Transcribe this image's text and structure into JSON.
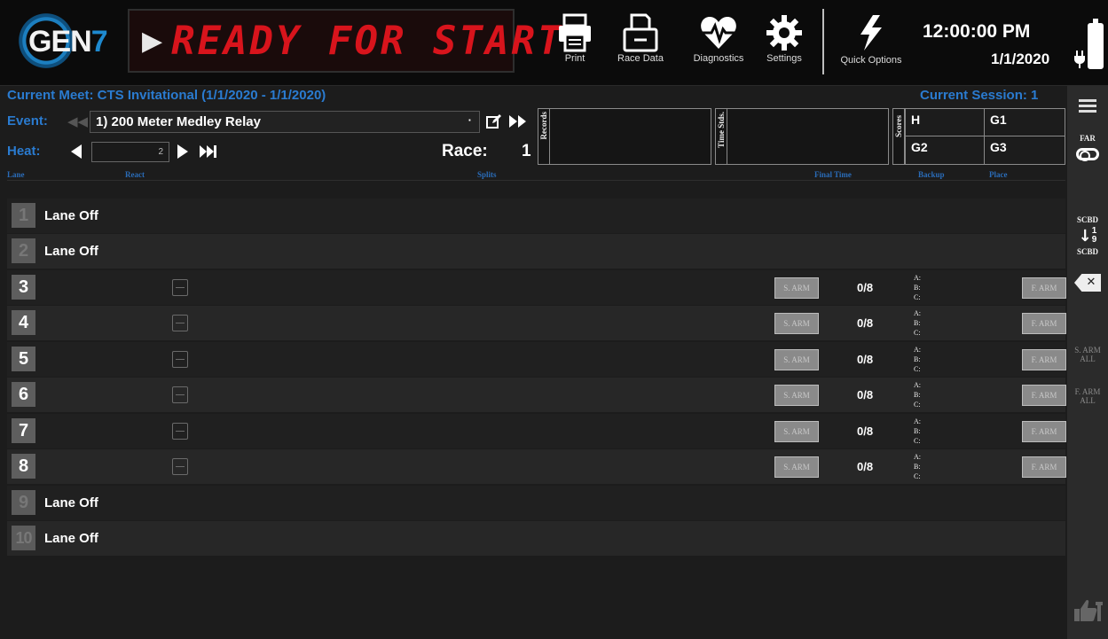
{
  "header": {
    "logo_text": "GEN",
    "logo_seven": "7",
    "status_arrow": "▶",
    "status_text": "READY FOR START",
    "tools": [
      {
        "label": "Print",
        "icon": "printer-icon"
      },
      {
        "label": "Race Data",
        "icon": "race-data-icon"
      },
      {
        "label": "Diagnostics",
        "icon": "heart-pulse-icon"
      },
      {
        "label": "Settings",
        "icon": "gear-icon"
      },
      {
        "label": "Quick Options",
        "icon": "lightning-icon"
      }
    ],
    "time": "12:00:00 PM",
    "date": "1/1/2020"
  },
  "meet": {
    "current_meet": "Current Meet: CTS Invitational (1/1/2020 - 1/1/2020)",
    "current_session": "Current Session: 1"
  },
  "controls": {
    "event_label": "Event:",
    "event_value": "1) 200 Meter Medley Relay",
    "heat_label": "Heat:",
    "heat_value": "2",
    "race_label": "Race:",
    "race_value": "1",
    "records_label": "Records",
    "time_stds_label": "Time Stds.",
    "scores_label": "Scores",
    "scores": [
      "H",
      "G1",
      "G2",
      "G3"
    ]
  },
  "columns": {
    "lane": "Lane",
    "react": "React",
    "splits": "Splits",
    "final_time": "Final Time",
    "backup": "Backup",
    "place": "Place"
  },
  "sidebar": {
    "far": "FAR",
    "scbd_top": "SCBD",
    "scbd_num_top": "1",
    "scbd_num_bottom": "9",
    "scbd_bottom": "SCBD",
    "s_arm_all_1": "S. ARM",
    "s_arm_all_2": "ALL",
    "f_arm_all_1": "F. ARM",
    "f_arm_all_2": "ALL"
  },
  "lanes": [
    {
      "num": "1",
      "status": "Lane Off"
    },
    {
      "num": "2",
      "status": "Lane Off"
    },
    {
      "num": "3",
      "s_arm": "S. ARM",
      "count": "0/8",
      "a": "A:",
      "b": "B:",
      "c": "C:",
      "f_arm": "F. ARM"
    },
    {
      "num": "4",
      "s_arm": "S. ARM",
      "count": "0/8",
      "a": "A:",
      "b": "B:",
      "c": "C:",
      "f_arm": "F. ARM"
    },
    {
      "num": "5",
      "s_arm": "S. ARM",
      "count": "0/8",
      "a": "A:",
      "b": "B:",
      "c": "C:",
      "f_arm": "F. ARM"
    },
    {
      "num": "6",
      "s_arm": "S. ARM",
      "count": "0/8",
      "a": "A:",
      "b": "B:",
      "c": "C:",
      "f_arm": "F. ARM"
    },
    {
      "num": "7",
      "s_arm": "S. ARM",
      "count": "0/8",
      "a": "A:",
      "b": "B:",
      "c": "C:",
      "f_arm": "F. ARM"
    },
    {
      "num": "8",
      "s_arm": "S. ARM",
      "count": "0/8",
      "a": "A:",
      "b": "B:",
      "c": "C:",
      "f_arm": "F. ARM"
    },
    {
      "num": "9",
      "status": "Lane Off"
    },
    {
      "num": "10",
      "status": "Lane Off"
    }
  ]
}
